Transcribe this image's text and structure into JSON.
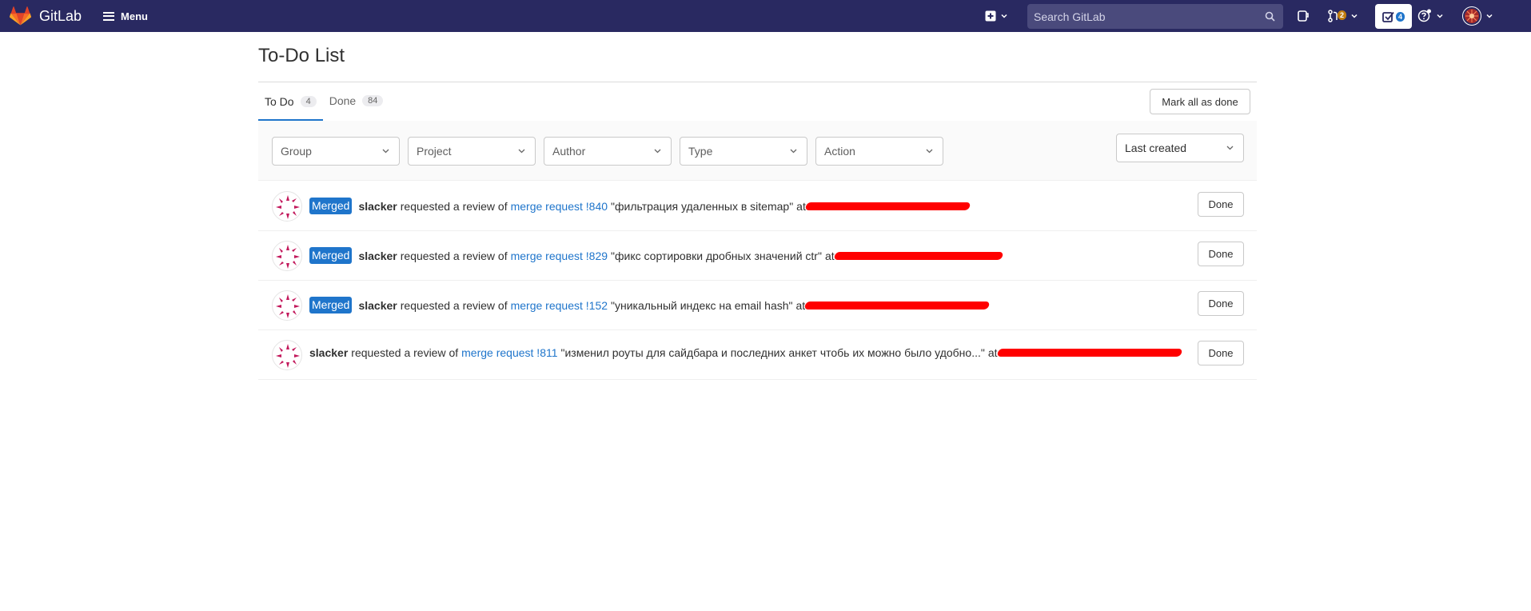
{
  "navbar": {
    "brand": "GitLab",
    "menu_label": "Menu",
    "search_placeholder": "Search GitLab",
    "merge_requests_count": "2",
    "todos_count": "4",
    "bg_color": "#292961"
  },
  "page": {
    "title": "To-Do List"
  },
  "tabs": [
    {
      "label": "To Do",
      "count": "4",
      "active": true
    },
    {
      "label": "Done",
      "count": "84",
      "active": false
    }
  ],
  "mark_all_label": "Mark all as done",
  "filters": {
    "group": "Group",
    "project": "Project",
    "author": "Author",
    "type": "Type",
    "action": "Action",
    "sort": "Last created"
  },
  "todos": [
    {
      "state": "Merged",
      "author": "slacker",
      "action": "requested a review of",
      "target": "merge request !840",
      "title": "\"фильтрация удаленных в sitemap\"",
      "at": "at",
      "done_label": "Done"
    },
    {
      "state": "Merged",
      "author": "slacker",
      "action": "requested a review of",
      "target": "merge request !829",
      "title": "\"фикс сортировки дробных значений ctr\"",
      "at": "at",
      "done_label": "Done"
    },
    {
      "state": "Merged",
      "author": "slacker",
      "action": "requested a review of",
      "target": "merge request !152",
      "title": "\"уникальный индекс на email hash\"",
      "at": "at",
      "done_label": "Done"
    },
    {
      "state": "",
      "author": "slacker",
      "action": "requested a review of",
      "target": "merge request !811",
      "title": "\"изменил роуты для сайдбара и последних анкет чтобь их можно было удобно...\"",
      "at": "at",
      "done_label": "Done"
    }
  ],
  "colors": {
    "accent": "#1f75cb",
    "merged_badge": "#1f75cb",
    "redaction": "#ff0000"
  }
}
